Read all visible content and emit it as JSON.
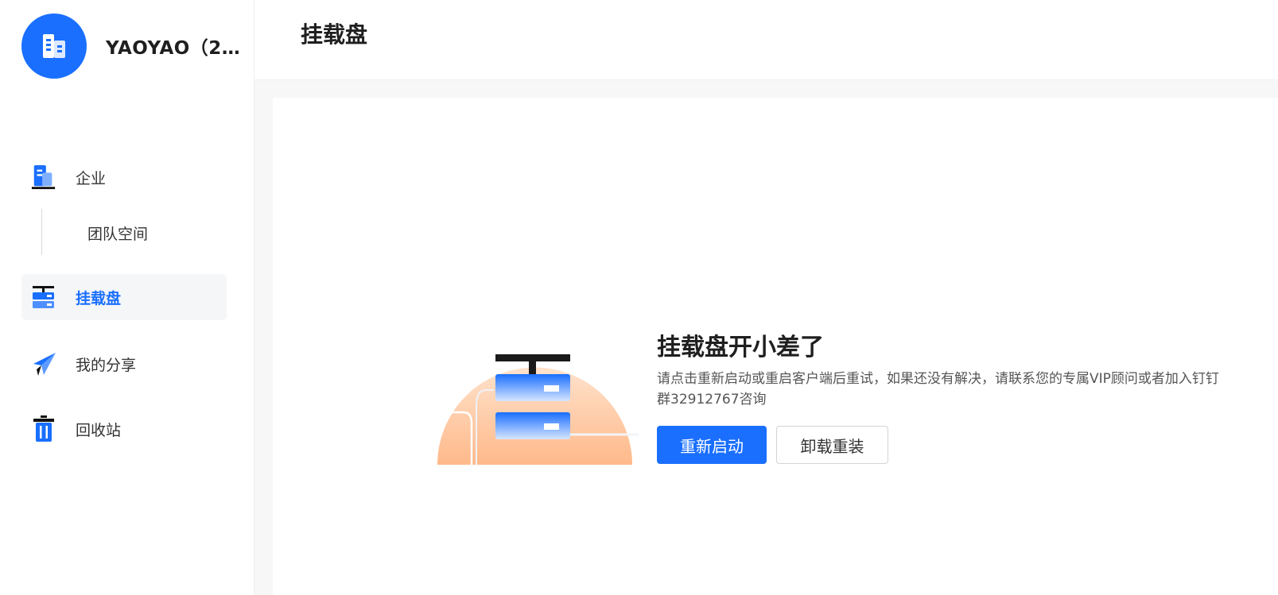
{
  "org": {
    "name": "YAOYAO（2..."
  },
  "sidebar": {
    "items": [
      {
        "id": "enterprise",
        "label": "企业",
        "icon": "building-icon"
      },
      {
        "id": "mounted-disk",
        "label": "挂载盘",
        "icon": "server-icon",
        "active": true
      },
      {
        "id": "my-share",
        "label": "我的分享",
        "icon": "paper-plane-icon"
      },
      {
        "id": "recycle-bin",
        "label": "回收站",
        "icon": "trash-icon"
      }
    ],
    "sub_items": [
      {
        "label": "团队空间"
      }
    ]
  },
  "header": {
    "title": "挂载盘"
  },
  "error": {
    "title": "挂载盘开小差了",
    "description": "请点击重新启动或重启客户端后重试，如果还没有解决，请联系您的专属VIP顾问或者加入钉钉群32912767咨询",
    "primary_button": "重新启动",
    "secondary_button": "卸载重装"
  },
  "colors": {
    "accent": "#1a6fff",
    "illustration_orange": "#ffb98a"
  }
}
